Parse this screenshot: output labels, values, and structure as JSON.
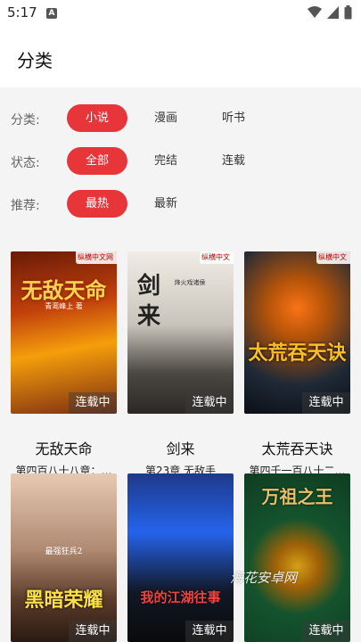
{
  "status_bar": {
    "time": "5:17",
    "app_icon_letter": "A"
  },
  "header": {
    "title": "分类"
  },
  "filters": [
    {
      "label": "分类:",
      "options": [
        "小说",
        "漫画",
        "听书"
      ],
      "selected": "小说"
    },
    {
      "label": "状态:",
      "options": [
        "全部",
        "完结",
        "连载"
      ],
      "selected": "全部"
    },
    {
      "label": "推荐:",
      "options": [
        "最热",
        "最新"
      ],
      "selected": "最热"
    }
  ],
  "books": [
    {
      "title": "无敌天命",
      "chapter": "第四百八十八章：…",
      "status": "连载中",
      "cover_text": "无敌天命",
      "cover_sub": "青鸾峰上 著",
      "publisher": "纵横中文网"
    },
    {
      "title": "剑来",
      "chapter": "第23章 无敌手",
      "status": "连载中",
      "cover_text": "剑来",
      "cover_sub": "烽火戏诸侯",
      "publisher": "纵横中文"
    },
    {
      "title": "太荒吞天诀",
      "chapter": "第四千一百八十二…",
      "status": "连载中",
      "cover_text": "太荒吞天诀",
      "cover_sub": "",
      "publisher": "纵横中文"
    },
    {
      "title": "",
      "chapter": "",
      "status": "连载中",
      "cover_text": "黑暗荣耀",
      "cover_sub": "最强狂兵2",
      "publisher": ""
    },
    {
      "title": "",
      "chapter": "",
      "status": "连载中",
      "cover_text": "我的江湖往事",
      "cover_sub": "",
      "publisher": ""
    },
    {
      "title": "",
      "chapter": "",
      "status": "连载中",
      "cover_text": "万祖之王",
      "cover_sub": "",
      "publisher": ""
    }
  ],
  "watermark": "海花安卓网",
  "colors": {
    "accent": "#e8353a",
    "background": "#f4f4f4"
  }
}
